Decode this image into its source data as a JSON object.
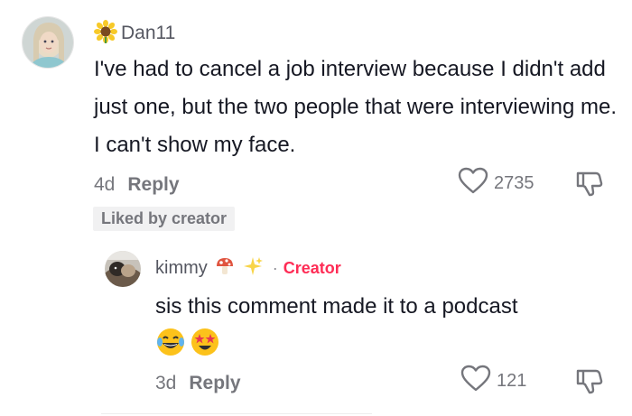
{
  "comment": {
    "username": "Dan11",
    "badge_icon": "sunflower-icon",
    "text": "I've had to cancel a job interview because I didn't add just one, but the two people that were interviewing me. I can't show my face.",
    "age": "4d",
    "reply_label": "Reply",
    "like_count": "2735",
    "liked_by_creator": "Liked by creator"
  },
  "reply": {
    "username": "kimmy",
    "deco_icons": [
      "mushroom-icon",
      "sparkles-icon"
    ],
    "separator": "·",
    "role": "Creator",
    "text": "sis this comment made it to a podcast",
    "emojis": [
      "laughing-tears-icon",
      "star-struck-icon"
    ],
    "age": "3d",
    "reply_label": "Reply",
    "like_count": "121"
  },
  "colors": {
    "text_primary": "#161823",
    "text_secondary": "#75767c",
    "creator_accent": "#fe2c55",
    "badge_bg": "#f1f1f2"
  }
}
